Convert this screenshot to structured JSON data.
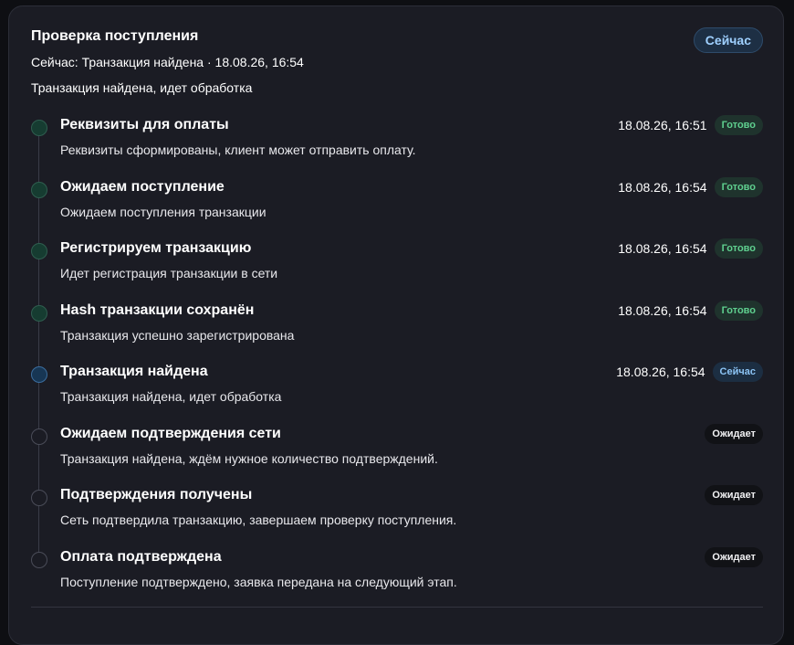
{
  "header": {
    "title": "Проверка поступления",
    "current": "Сейчас: Транзакция найдена · 18.08.26, 16:54",
    "current_desc": "Транзакция найдена, идет обработка",
    "badge": "Сейчас"
  },
  "colors": {
    "background": "#1b1c24",
    "done": "#5fd08f",
    "now": "#8cc4f5",
    "wait": "#f2f2f4"
  },
  "steps": [
    {
      "title": "Реквизиты для оплаты",
      "desc": "Реквизиты сформированы, клиент может отправить оплату.",
      "time": "18.08.26, 16:51",
      "status": "done",
      "badge": "Готово"
    },
    {
      "title": "Ожидаем поступление",
      "desc": "Ожидаем поступления транзакции",
      "time": "18.08.26, 16:54",
      "status": "done",
      "badge": "Готово"
    },
    {
      "title": "Регистрируем транзакцию",
      "desc": "Идет регистрация транзакции в сети",
      "time": "18.08.26, 16:54",
      "status": "done",
      "badge": "Готово"
    },
    {
      "title": "Hash транзакции сохранён",
      "desc": "Транзакция успешно зарегистрирована",
      "time": "18.08.26, 16:54",
      "status": "done",
      "badge": "Готово"
    },
    {
      "title": "Транзакция найдена",
      "desc": "Транзакция найдена, идет обработка",
      "time": "18.08.26, 16:54",
      "status": "now",
      "badge": "Сейчас"
    },
    {
      "title": "Ожидаем подтверждения сети",
      "desc": "Транзакция найдена, ждём нужное количество подтверждений.",
      "time": "",
      "status": "wait",
      "badge": "Ожидает"
    },
    {
      "title": "Подтверждения получены",
      "desc": "Сеть подтвердила транзакцию, завершаем проверку поступления.",
      "time": "",
      "status": "wait",
      "badge": "Ожидает"
    },
    {
      "title": "Оплата подтверждена",
      "desc": "Поступление подтверждено, заявка передана на следующий этап.",
      "time": "",
      "status": "wait",
      "badge": "Ожидает"
    }
  ]
}
